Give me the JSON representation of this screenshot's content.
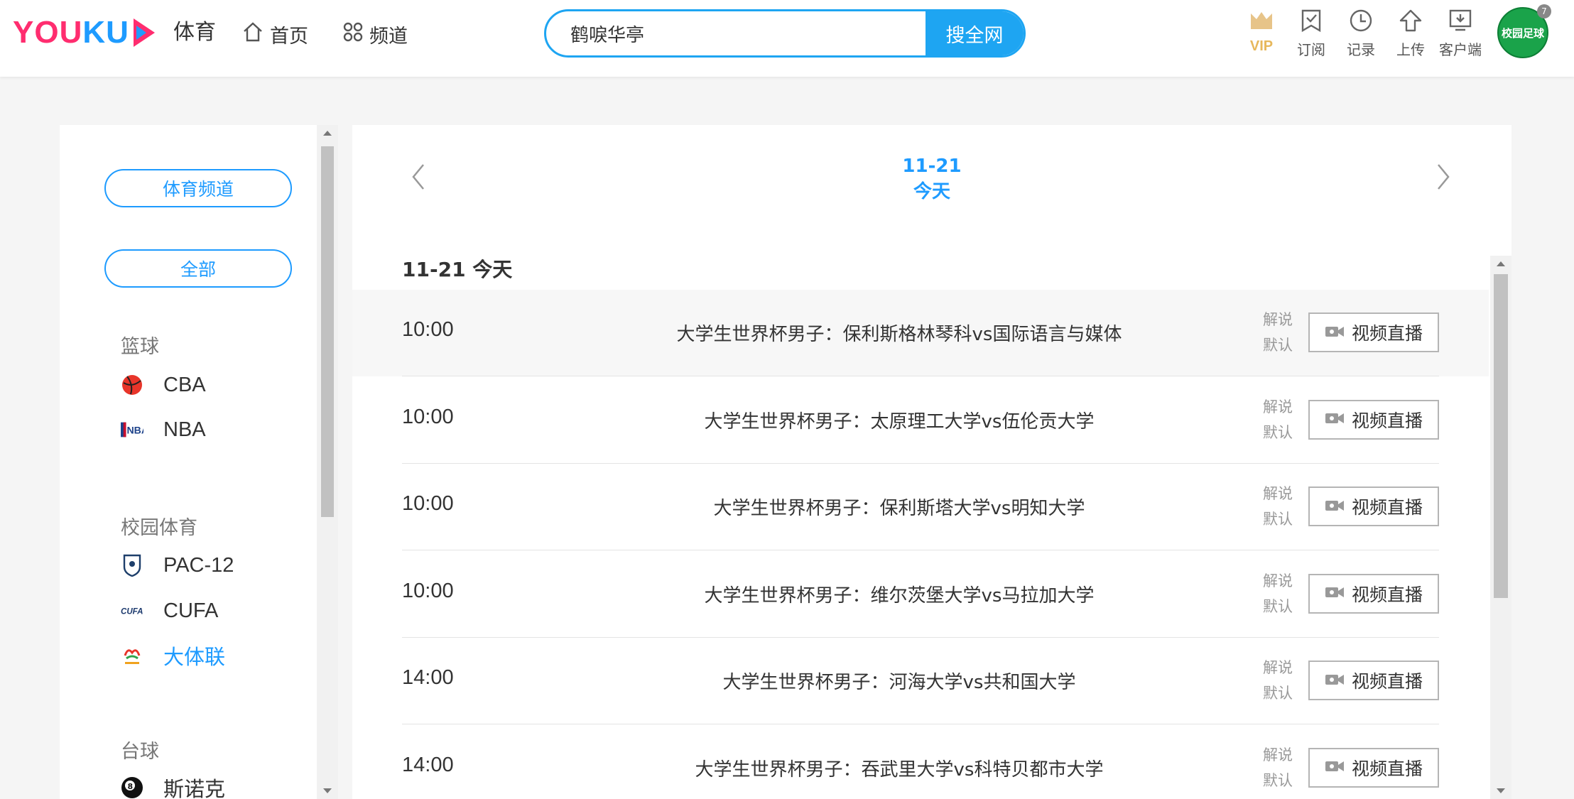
{
  "header": {
    "logo_text_a": "YOU",
    "logo_text_b": "KU",
    "logo_sub": "体育",
    "nav": [
      {
        "label": "首页",
        "icon": "home-icon"
      },
      {
        "label": "频道",
        "icon": "grid-icon"
      }
    ],
    "search": {
      "value": "鹤唳华亭",
      "button": "搜全网"
    },
    "tools": [
      {
        "label": "VIP",
        "icon": "crown-icon"
      },
      {
        "label": "订阅",
        "icon": "bookmark-icon"
      },
      {
        "label": "记录",
        "icon": "clock-icon"
      },
      {
        "label": "上传",
        "icon": "upload-icon"
      },
      {
        "label": "客户端",
        "icon": "download-icon"
      }
    ],
    "avatar_text": "校园足球",
    "badge": "7"
  },
  "sidebar": {
    "pill_sports": "体育频道",
    "pill_all": "全部",
    "categories": [
      {
        "title": "篮球",
        "leagues": [
          "CBA",
          "NBA"
        ]
      },
      {
        "title": "校园体育",
        "leagues": [
          "PAC-12",
          "CUFA",
          "大体联"
        ]
      },
      {
        "title": "台球",
        "leagues": [
          "斯诺克"
        ]
      }
    ],
    "active_league": "大体联"
  },
  "main": {
    "date": "11-21",
    "date_label": "今天",
    "section_title": "11-21 今天",
    "matches": [
      {
        "time": "10:00",
        "title": "大学生世界杯男子：保利斯格林琴科vs国际语言与媒体",
        "meta1": "解说",
        "meta2": "默认",
        "button": "视频直播"
      },
      {
        "time": "10:00",
        "title": "大学生世界杯男子：太原理工大学vs伍伦贡大学",
        "meta1": "解说",
        "meta2": "默认",
        "button": "视频直播"
      },
      {
        "time": "10:00",
        "title": "大学生世界杯男子：保利斯塔大学vs明知大学",
        "meta1": "解说",
        "meta2": "默认",
        "button": "视频直播"
      },
      {
        "time": "10:00",
        "title": "大学生世界杯男子：维尔茨堡大学vs马拉加大学",
        "meta1": "解说",
        "meta2": "默认",
        "button": "视频直播"
      },
      {
        "time": "14:00",
        "title": "大学生世界杯男子：河海大学vs共和国大学",
        "meta1": "解说",
        "meta2": "默认",
        "button": "视频直播"
      },
      {
        "time": "14:00",
        "title": "大学生世界杯男子：吞武里大学vs科特贝都市大学",
        "meta1": "解说",
        "meta2": "默认",
        "button": "视频直播"
      }
    ]
  }
}
